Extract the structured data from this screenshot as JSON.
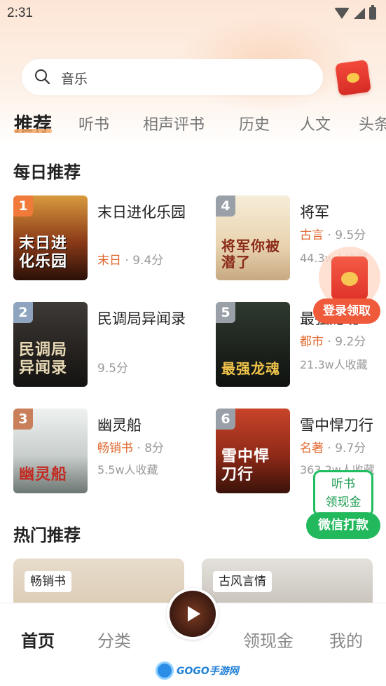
{
  "status_bar": {
    "time": "2:31"
  },
  "search": {
    "placeholder": "音乐"
  },
  "tabs": [
    {
      "label": "推荐",
      "active": true
    },
    {
      "label": "听书"
    },
    {
      "label": "相声评书"
    },
    {
      "label": "历史"
    },
    {
      "label": "人文"
    },
    {
      "label": "头条"
    }
  ],
  "daily": {
    "title": "每日推荐",
    "books": [
      {
        "rank": "1",
        "title": "末日进化乐园",
        "category": "末日",
        "score": "9.4分",
        "stats": "",
        "cover_text": "末日进化乐园"
      },
      {
        "rank": "4",
        "title": "将军",
        "category": "古言",
        "score": "9.5分",
        "stats": "44.3w人收藏",
        "cover_text": "将军你被潜了"
      },
      {
        "rank": "2",
        "title": "民调局异闻录",
        "category": "",
        "score": "9.5分",
        "stats": "",
        "cover_text": "民调局异闻录"
      },
      {
        "rank": "5",
        "title": "最强龙魂",
        "category": "都市",
        "score": "9.2分",
        "stats": "21.3w人收藏",
        "cover_text": "最强龙魂"
      },
      {
        "rank": "3",
        "title": "幽灵船",
        "category": "畅销书",
        "score": "8分",
        "stats": "5.5w人收藏",
        "cover_text": "幽灵船"
      },
      {
        "rank": "6",
        "title": "雪中悍刀行",
        "category": "名著",
        "score": "9.7分",
        "stats": "363.2w人收藏",
        "cover_text": "雪中悍刀行"
      }
    ]
  },
  "floating": {
    "login_reward": "登录领取",
    "cash_line1": "听书",
    "cash_line2": "领现金",
    "cash_pill": "微信打款"
  },
  "hot": {
    "title": "热门推荐",
    "cards": [
      {
        "tag": "畅销书"
      },
      {
        "tag": "古风言情"
      }
    ]
  },
  "bottom_nav": [
    {
      "label": "首页",
      "active": true
    },
    {
      "label": "分类"
    },
    {
      "label": "领现金"
    },
    {
      "label": "我的"
    }
  ],
  "watermark": {
    "text": "GOGO手游网"
  },
  "colors": {
    "accent": "#e0682f",
    "green": "#22b85c",
    "red": "#ef5a3a"
  }
}
